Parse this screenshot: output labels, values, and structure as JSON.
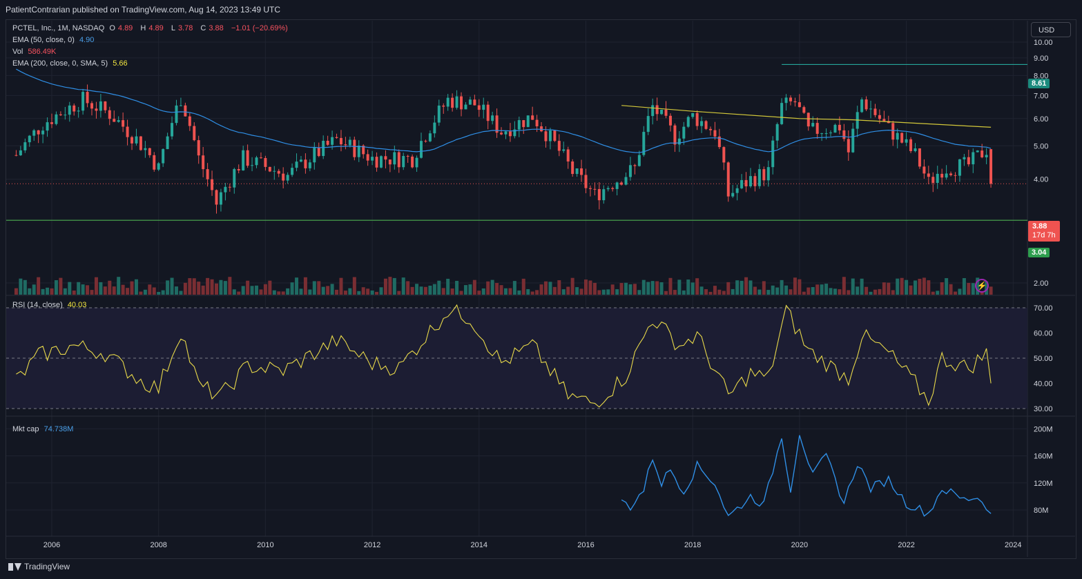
{
  "header": {
    "published": "PatientContrarian published on TradingView.com, Aug 14, 2023 13:49 UTC"
  },
  "legend": {
    "symbol": "PCTEL, Inc., 1M, NASDAQ",
    "o_label": "O",
    "o_value": "4.89",
    "h_label": "H",
    "h_value": "4.89",
    "l_label": "L",
    "l_value": "3.78",
    "c_label": "C",
    "c_value": "3.88",
    "change": "−1.01 (−20.69%)",
    "ema50_label": "EMA (50, close, 0)",
    "ema50_value": "4.90",
    "vol_label": "Vol",
    "vol_value": "586.49K",
    "ema200_label": "EMA (200, close, 0, SMA, 5)",
    "ema200_value": "5.66",
    "rsi_label": "RSI (14, close)",
    "rsi_value": "40.03",
    "mktcap_label": "Mkt cap",
    "mktcap_value": "74.738M"
  },
  "currency": "USD",
  "price_tags": {
    "resistance": "8.61",
    "last_price": "3.88",
    "countdown": "17d 7h",
    "support": "3.04"
  },
  "footer": {
    "brand": "TradingView"
  },
  "colors": {
    "background": "#131722",
    "up": "#26a69a",
    "down": "#ef5350",
    "ema50": "#2f8fe6",
    "ema200": "#d4c93a",
    "rsi": "#e8d94a",
    "mktcap": "#2f8fe6",
    "support": "#4caf50",
    "resistance": "#26a69a"
  },
  "chart_data": [
    {
      "type": "candlestick",
      "title": "PCTEL, Inc., 1M, NASDAQ",
      "x_axis_ticks": [
        "2006",
        "2008",
        "2010",
        "2012",
        "2014",
        "2016",
        "2018",
        "2020",
        "2022",
        "2024"
      ],
      "y_axis_ticks": [
        "2.00",
        "4.00",
        "5.00",
        "6.00",
        "7.00",
        "8.00",
        "9.00",
        "10.00"
      ],
      "ylim": [
        1.7,
        10.2
      ],
      "date_range": [
        "2005-05",
        "2023-08"
      ],
      "price_path": [
        {
          "date": "2005-05",
          "close": 4.7
        },
        {
          "date": "2005-11",
          "close": 5.8
        },
        {
          "date": "2006-08",
          "close": 6.8
        },
        {
          "date": "2007-02",
          "close": 6.2
        },
        {
          "date": "2007-10",
          "close": 4.9
        },
        {
          "date": "2008-01",
          "close": 4.3
        },
        {
          "date": "2008-06",
          "close": 6.9
        },
        {
          "date": "2008-10",
          "close": 4.6
        },
        {
          "date": "2009-02",
          "close": 3.4
        },
        {
          "date": "2009-08",
          "close": 4.6
        },
        {
          "date": "2010-06",
          "close": 4.1
        },
        {
          "date": "2011-05",
          "close": 5.2
        },
        {
          "date": "2012-01",
          "close": 4.6
        },
        {
          "date": "2012-10",
          "close": 4.6
        },
        {
          "date": "2013-06",
          "close": 6.8
        },
        {
          "date": "2013-12",
          "close": 6.6
        },
        {
          "date": "2014-06",
          "close": 5.5
        },
        {
          "date": "2015-01",
          "close": 6.1
        },
        {
          "date": "2015-10",
          "close": 4.2
        },
        {
          "date": "2016-03",
          "close": 3.6
        },
        {
          "date": "2016-12",
          "close": 4.3
        },
        {
          "date": "2017-04",
          "close": 6.5
        },
        {
          "date": "2017-09",
          "close": 5.3
        },
        {
          "date": "2018-01",
          "close": 6.1
        },
        {
          "date": "2018-06",
          "close": 5.5
        },
        {
          "date": "2018-09",
          "close": 3.6
        },
        {
          "date": "2019-02",
          "close": 4.0
        },
        {
          "date": "2019-06",
          "close": 4.2
        },
        {
          "date": "2019-09",
          "close": 6.5
        },
        {
          "date": "2019-12",
          "close": 6.7
        },
        {
          "date": "2020-03",
          "close": 5.5
        },
        {
          "date": "2020-10",
          "close": 5.7
        },
        {
          "date": "2020-12",
          "close": 4.8
        },
        {
          "date": "2021-03",
          "close": 6.8
        },
        {
          "date": "2021-09",
          "close": 5.6
        },
        {
          "date": "2022-03",
          "close": 4.7
        },
        {
          "date": "2022-06",
          "close": 3.9
        },
        {
          "date": "2022-09",
          "close": 4.3
        },
        {
          "date": "2023-03",
          "close": 4.4
        },
        {
          "date": "2023-07",
          "close": 4.9
        },
        {
          "date": "2023-08",
          "close": 3.88
        }
      ],
      "last": {
        "open": 4.89,
        "high": 4.89,
        "low": 3.78,
        "close": 3.88
      },
      "horizontal_lines": [
        {
          "name": "resistance",
          "value": 8.61,
          "from": "2019-09"
        },
        {
          "name": "support",
          "value": 3.04
        },
        {
          "name": "last-price",
          "value": 3.88,
          "style": "dotted"
        }
      ],
      "ema200_path": [
        {
          "date": "2016-09",
          "value": 6.55
        },
        {
          "date": "2018-01",
          "value": 6.3
        },
        {
          "date": "2020-01",
          "value": 6.0
        },
        {
          "date": "2021-01",
          "value": 5.95
        },
        {
          "date": "2023-08",
          "value": 5.66
        }
      ]
    },
    {
      "type": "line",
      "title": "RSI (14, close)",
      "y_axis_ticks": [
        "30.00",
        "40.00",
        "50.00",
        "60.00",
        "70.00"
      ],
      "ylim": [
        27,
        73
      ],
      "bands": [
        30,
        50,
        70
      ],
      "points": [
        {
          "date": "2005-05",
          "value": 41
        },
        {
          "date": "2005-10",
          "value": 51
        },
        {
          "date": "2006-06",
          "value": 55
        },
        {
          "date": "2007-01",
          "value": 52
        },
        {
          "date": "2007-09",
          "value": 41
        },
        {
          "date": "2008-01",
          "value": 38
        },
        {
          "date": "2008-06",
          "value": 61
        },
        {
          "date": "2008-10",
          "value": 39
        },
        {
          "date": "2009-03",
          "value": 35
        },
        {
          "date": "2009-09",
          "value": 47
        },
        {
          "date": "2010-05",
          "value": 45
        },
        {
          "date": "2011-05",
          "value": 57
        },
        {
          "date": "2012-01",
          "value": 48
        },
        {
          "date": "2012-07",
          "value": 46
        },
        {
          "date": "2013-06",
          "value": 69
        },
        {
          "date": "2013-11",
          "value": 66
        },
        {
          "date": "2014-06",
          "value": 48
        },
        {
          "date": "2015-01",
          "value": 55
        },
        {
          "date": "2015-09",
          "value": 35
        },
        {
          "date": "2016-03",
          "value": 32
        },
        {
          "date": "2016-10",
          "value": 43
        },
        {
          "date": "2017-04",
          "value": 66
        },
        {
          "date": "2017-10",
          "value": 55
        },
        {
          "date": "2018-02",
          "value": 59
        },
        {
          "date": "2018-09",
          "value": 35
        },
        {
          "date": "2019-02",
          "value": 44
        },
        {
          "date": "2019-06",
          "value": 42
        },
        {
          "date": "2019-10",
          "value": 69
        },
        {
          "date": "2020-03",
          "value": 53
        },
        {
          "date": "2020-12",
          "value": 42
        },
        {
          "date": "2021-03",
          "value": 59
        },
        {
          "date": "2021-09",
          "value": 52
        },
        {
          "date": "2022-03",
          "value": 40
        },
        {
          "date": "2022-06",
          "value": 33
        },
        {
          "date": "2022-09",
          "value": 50
        },
        {
          "date": "2023-03",
          "value": 46
        },
        {
          "date": "2023-07",
          "value": 52
        },
        {
          "date": "2023-08",
          "value": 40.03
        }
      ]
    },
    {
      "type": "line",
      "title": "Mkt cap",
      "y_axis_ticks": [
        "80M",
        "120M",
        "160M",
        "200M"
      ],
      "ylim": [
        60,
        210
      ],
      "unit": "M",
      "points": [
        {
          "date": "2016-09",
          "value": 95
        },
        {
          "date": "2016-11",
          "value": 85
        },
        {
          "date": "2017-02",
          "value": 110
        },
        {
          "date": "2017-04",
          "value": 158
        },
        {
          "date": "2017-06",
          "value": 120
        },
        {
          "date": "2017-08",
          "value": 140
        },
        {
          "date": "2017-11",
          "value": 108
        },
        {
          "date": "2018-02",
          "value": 145
        },
        {
          "date": "2018-06",
          "value": 120
        },
        {
          "date": "2018-09",
          "value": 70
        },
        {
          "date": "2019-02",
          "value": 100
        },
        {
          "date": "2019-05",
          "value": 88
        },
        {
          "date": "2019-09",
          "value": 190
        },
        {
          "date": "2019-11",
          "value": 110
        },
        {
          "date": "2020-01",
          "value": 195
        },
        {
          "date": "2020-04",
          "value": 130
        },
        {
          "date": "2020-07",
          "value": 160
        },
        {
          "date": "2020-11",
          "value": 90
        },
        {
          "date": "2021-02",
          "value": 150
        },
        {
          "date": "2021-05",
          "value": 112
        },
        {
          "date": "2021-09",
          "value": 125
        },
        {
          "date": "2022-01",
          "value": 90
        },
        {
          "date": "2022-06",
          "value": 75
        },
        {
          "date": "2022-09",
          "value": 112
        },
        {
          "date": "2023-02",
          "value": 95
        },
        {
          "date": "2023-05",
          "value": 100
        },
        {
          "date": "2023-08",
          "value": 74.738
        }
      ]
    }
  ]
}
